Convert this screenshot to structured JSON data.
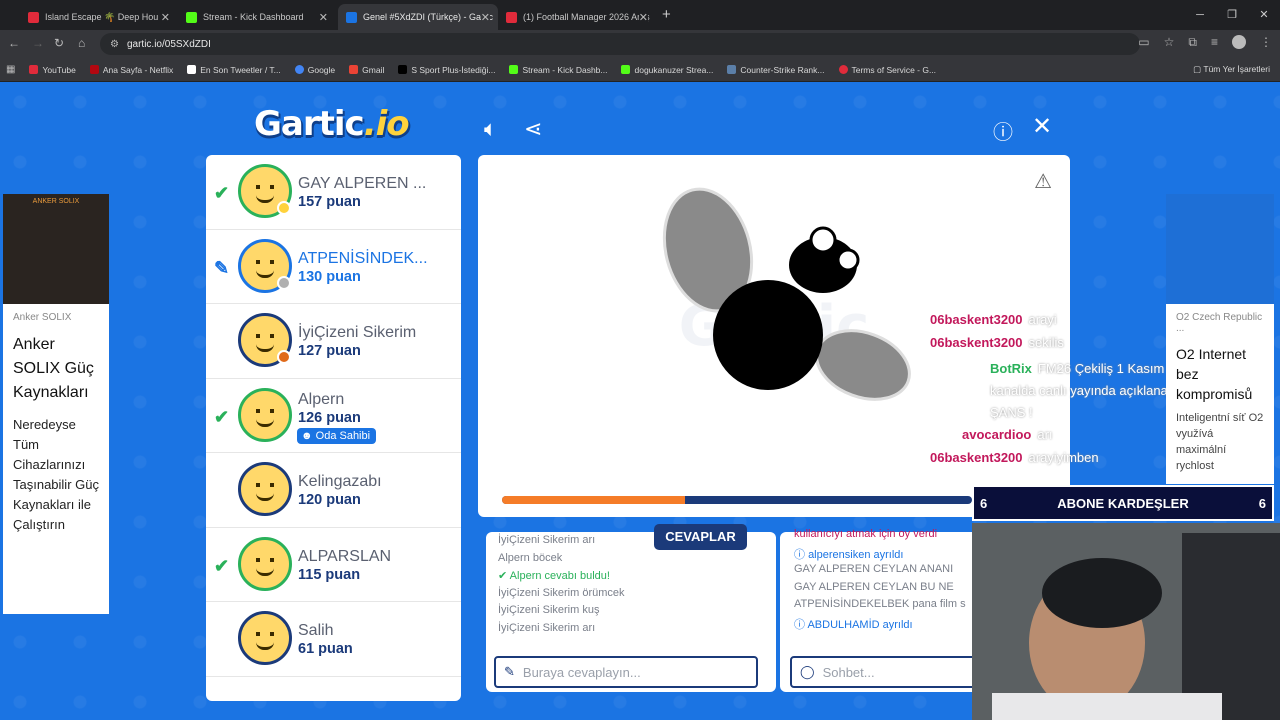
{
  "browser": {
    "tabs": [
      {
        "label": "Island Escape 🌴 Deep Hou",
        "color": "#e02b3b"
      },
      {
        "label": "Stream - Kick Dashboard",
        "color": "#53fc18"
      },
      {
        "label": "Genel #5XdZDI (Türkçe) - Gartic",
        "color": "#1b74e3"
      },
      {
        "label": "(1) Football Manager 2026 Araş",
        "color": "#e02b3b"
      }
    ],
    "url": "gartic.io/05SXdZDI",
    "bookmarks": [
      {
        "label": "YouTube",
        "color": "#e02b3b"
      },
      {
        "label": "Ana Sayfa - Netflix",
        "color": "#b20710"
      },
      {
        "label": "En Son Tweetler / T...",
        "color": "#ffffff"
      },
      {
        "label": "Google",
        "color": "#4285f4"
      },
      {
        "label": "Gmail",
        "color": "#ea4335"
      },
      {
        "label": "S Sport Plus-İstediği...",
        "color": "#000000"
      },
      {
        "label": "Stream - Kick Dashb...",
        "color": "#53fc18"
      },
      {
        "label": "dogukanuzer Strea...",
        "color": "#53fc18"
      },
      {
        "label": "Counter-Strike Rank...",
        "color": "#5b7fa8"
      },
      {
        "label": "Terms of Service - G...",
        "color": "#e02b3b"
      }
    ],
    "bookmarks_all": "Tüm Yer İşaretleri"
  },
  "game": {
    "logo_main": "Gartic",
    "logo_suffix": ".io",
    "players": [
      {
        "name": "GAY ALPEREN ...",
        "score": "157 puan",
        "mark": "check",
        "ring": "#2ab15a",
        "status": "#ffd23c"
      },
      {
        "name": "ATPENİSİNDEK...",
        "score": "130 puan",
        "mark": "pencil",
        "ring": "#1b74e3",
        "status": "#b0b0b0"
      },
      {
        "name": "İyiÇizeni Sikerim",
        "score": "127 puan",
        "mark": "",
        "ring": "#1b3a7a",
        "status": "#e06a1a"
      },
      {
        "name": "Alpern",
        "score": "126 puan",
        "mark": "check",
        "ring": "#2ab15a",
        "status": "",
        "badge": "Oda Sahibi"
      },
      {
        "name": "Kelingazabı",
        "score": "120 puan",
        "mark": "",
        "ring": "#1b3a7a",
        "status": ""
      },
      {
        "name": "ALPARSLAN",
        "score": "115 puan",
        "mark": "check",
        "ring": "#2ab15a",
        "status": ""
      },
      {
        "name": "Salih",
        "score": "61 puan",
        "mark": "",
        "ring": "#1b3a7a",
        "status": ""
      }
    ],
    "timer_progress": 0.39,
    "overlay_chat": [
      {
        "user": "06baskent3200",
        "msg": "arayi",
        "color": "#c2185b"
      },
      {
        "user": "06baskent3200",
        "msg": "sekilis",
        "color": "#c2185b"
      },
      {
        "user": "BotRix",
        "msg": "FM26 Çekiliş 1 Kasım tarihinde bu kanalda canlı yayında açıklanacaktır. BOL ŞANS !",
        "color": "#2ab15a"
      },
      {
        "user": "avocardioo",
        "msg": "arı",
        "color": "#c2185b"
      },
      {
        "user": "06baskent3200",
        "msg": "arayiyimben",
        "color": "#c2185b"
      }
    ],
    "answers_title": "CEVAPLAR",
    "answers": [
      {
        "text": "İyiÇizeni Sikerim arı",
        "type": "normal"
      },
      {
        "text": "Alpern böcek",
        "type": "normal"
      },
      {
        "text": "Alpern cevabı buldu!",
        "type": "correct"
      },
      {
        "text": "İyiÇizeni Sikerim örümcek",
        "type": "normal"
      },
      {
        "text": "İyiÇizeni Sikerim kuş",
        "type": "normal"
      },
      {
        "text": "İyiÇizeni Sikerim arı",
        "type": "normal"
      }
    ],
    "answer_placeholder": "Buraya cevaplayın...",
    "chat": [
      {
        "text": "kullanıcıyı atmak için oy verdi",
        "type": "vote"
      },
      {
        "text": "alperensiken ayrıldı",
        "type": "sys"
      },
      {
        "text": "GAY ALPEREN CEYLAN ANANI",
        "type": "normal"
      },
      {
        "text": "GAY ALPEREN CEYLAN BU NE",
        "type": "normal"
      },
      {
        "text": "ATPENİSİNDEKELBEK pana film s",
        "type": "normal"
      },
      {
        "text": "ABDULHAMİD ayrıldı",
        "type": "sys"
      }
    ],
    "chat_placeholder": "Sohbet..."
  },
  "ads": {
    "left": {
      "brand": "Anker SOLIX",
      "headline": "Anker SOLIX Güç Kaynakları",
      "body": "Neredeyse Tüm Cihazlarınızı Taşınabilir Güç Kaynakları ile Çalıştırın",
      "banner": "ANKER SOLIX"
    },
    "right": {
      "brand": "O2 Czech Republic ...",
      "headline": "O2 Internet bez kompromisů",
      "body": "Inteligentní síť O2 využívá maximální rychlost"
    }
  },
  "stream": {
    "abone_text": "ABONE KARDEŞLER",
    "abone_left": "6",
    "abone_right": "6"
  }
}
